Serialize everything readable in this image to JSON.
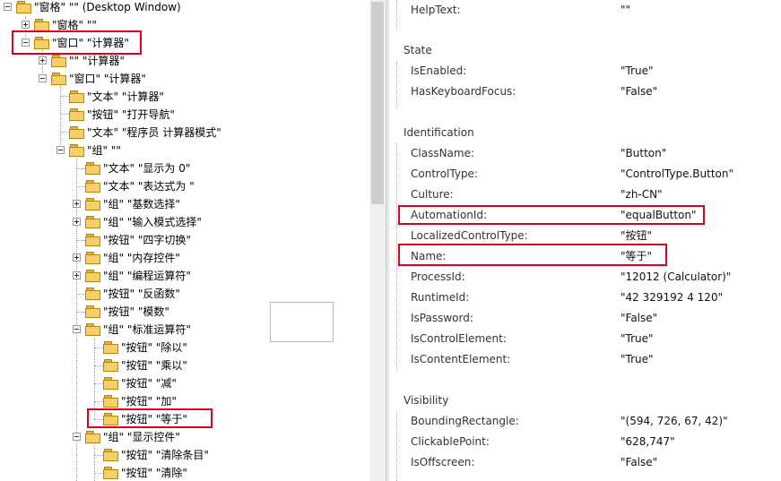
{
  "tree": {
    "nodes": [
      {
        "label": "\"窗格\" \"\" (Desktop Window)"
      },
      {
        "label": "\"窗格\" \"\""
      },
      {
        "label": "\"窗口\" \"计算器\""
      },
      {
        "label": "\"\" \"计算器\""
      },
      {
        "label": "\"窗口\" \"计算器\""
      },
      {
        "label": "\"文本\" \"计算器\""
      },
      {
        "label": "\"按钮\" \"打开导航\""
      },
      {
        "label": "\"文本\" \"程序员 计算器模式\""
      },
      {
        "label": "\"组\" \"\""
      },
      {
        "label": "\"文本\" \"显示为 0\""
      },
      {
        "label": "\"文本\" \"表达式为 \""
      },
      {
        "label": "\"组\" \"基数选择\""
      },
      {
        "label": "\"组\" \"输入模式选择\""
      },
      {
        "label": "\"按钮\" \"四字切换\""
      },
      {
        "label": "\"组\" \"内存控件\""
      },
      {
        "label": "\"组\" \"编程运算符\""
      },
      {
        "label": "\"按钮\" \"反函数\""
      },
      {
        "label": "\"按钮\" \"模数\""
      },
      {
        "label": "\"组\" \"标准运算符\""
      },
      {
        "label": "\"按钮\" \"除以\""
      },
      {
        "label": "\"按钮\" \"乘以\""
      },
      {
        "label": "\"按钮\" \"减\""
      },
      {
        "label": "\"按钮\" \"加\""
      },
      {
        "label": "\"按钮\" \"等于\""
      },
      {
        "label": "\"组\" \"显示控件\""
      },
      {
        "label": "\"按钮\" \"清除条目\""
      },
      {
        "label": "\"按钮\" \"清除\""
      }
    ]
  },
  "properties": {
    "helptext": {
      "name": "HelpText:",
      "value": "\"\""
    },
    "state": {
      "title": "State",
      "rows": [
        {
          "name": "IsEnabled:",
          "value": "\"True\""
        },
        {
          "name": "HasKeyboardFocus:",
          "value": "\"False\""
        }
      ]
    },
    "identification": {
      "title": "Identification",
      "rows": [
        {
          "name": "ClassName:",
          "value": "\"Button\""
        },
        {
          "name": "ControlType:",
          "value": "\"ControlType.Button\""
        },
        {
          "name": "Culture:",
          "value": "\"zh-CN\""
        },
        {
          "name": "AutomationId:",
          "value": "\"equalButton\""
        },
        {
          "name": "LocalizedControlType:",
          "value": "\"按钮\""
        },
        {
          "name": "Name:",
          "value": "\"等于\""
        },
        {
          "name": "ProcessId:",
          "value": "\"12012 (Calculator)\""
        },
        {
          "name": "RuntimeId:",
          "value": "\"42 329192 4 120\""
        },
        {
          "name": "IsPassword:",
          "value": "\"False\""
        },
        {
          "name": "IsControlElement:",
          "value": "\"True\""
        },
        {
          "name": "IsContentElement:",
          "value": "\"True\""
        }
      ]
    },
    "visibility": {
      "title": "Visibility",
      "rows": [
        {
          "name": "BoundingRectangle:",
          "value": "\"(594, 726, 67, 42)\""
        },
        {
          "name": "ClickablePoint:",
          "value": "\"628,747\""
        },
        {
          "name": "IsOffscreen:",
          "value": "\"False\""
        }
      ]
    }
  },
  "colors": {
    "highlight": "#e0001a",
    "folder": "#f5d06a"
  }
}
